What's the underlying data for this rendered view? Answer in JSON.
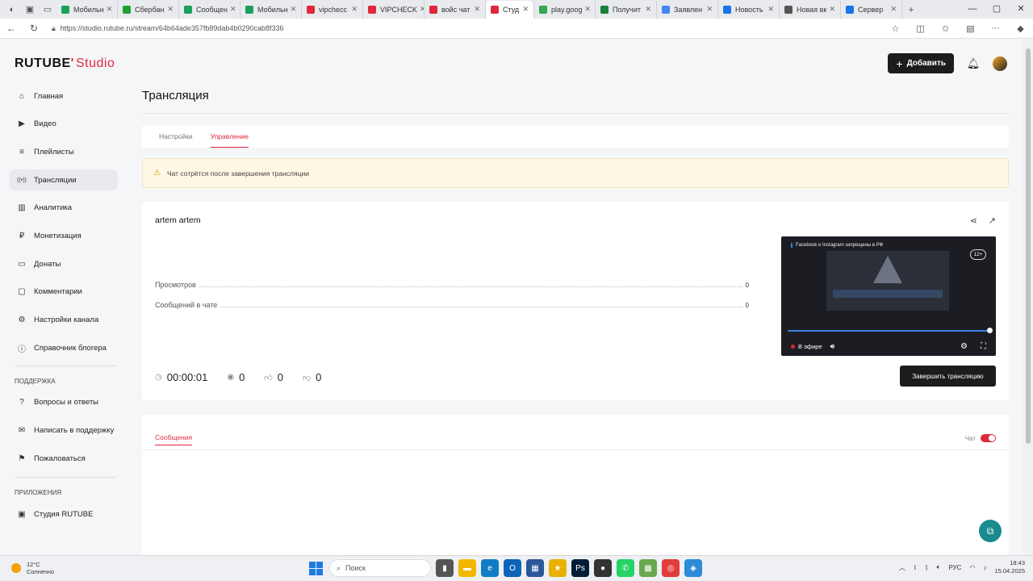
{
  "browser": {
    "tabs": [
      {
        "label": "Мобильн",
        "color": "#19a05b"
      },
      {
        "label": "Сбербан",
        "color": "#21a038"
      },
      {
        "label": "Сообщен",
        "color": "#19a05b"
      },
      {
        "label": "Мобильн",
        "color": "#19a05b"
      },
      {
        "label": "vipchecс",
        "color": "#e0283c"
      },
      {
        "label": "VIPCHECK",
        "color": "#e0283c"
      },
      {
        "label": "войс чат",
        "color": "#e0283c"
      },
      {
        "label": "Студ",
        "color": "#e0283c"
      },
      {
        "label": "play.goog",
        "color": "#34a853"
      },
      {
        "label": "Получит",
        "color": "#188038"
      },
      {
        "label": "Заявлен",
        "color": "#4285f4"
      },
      {
        "label": "Новость",
        "color": "#1a73e8"
      },
      {
        "label": "Новая вк",
        "color": "#555555"
      },
      {
        "label": "Сервер",
        "color": "#1a73e8"
      }
    ],
    "url": "https://studio.rutube.ru/stream/64b64ade357fb89dab4b0290cab8f336"
  },
  "app": {
    "logo": "RUTUBE",
    "logo_suffix": "Studio",
    "add_button": "Добавить"
  },
  "sidebar": {
    "items": [
      {
        "label": "Главная",
        "icon": "home-icon"
      },
      {
        "label": "Видео",
        "icon": "video-icon"
      },
      {
        "label": "Плейлисты",
        "icon": "playlist-icon"
      },
      {
        "label": "Трансляции",
        "icon": "broadcast-icon"
      },
      {
        "label": "Аналитика",
        "icon": "analytics-icon"
      },
      {
        "label": "Монетизация",
        "icon": "ruble-icon"
      },
      {
        "label": "Донаты",
        "icon": "donate-icon"
      },
      {
        "label": "Комментарии",
        "icon": "comment-icon"
      },
      {
        "label": "Настройки канала",
        "icon": "gear-icon"
      },
      {
        "label": "Справочник блогера",
        "icon": "info-icon"
      }
    ],
    "support_heading": "ПОДДЕРЖКА",
    "support_items": [
      {
        "label": "Вопросы и ответы"
      },
      {
        "label": "Написать в поддержку"
      },
      {
        "label": "Пожаловаться"
      }
    ],
    "apps_heading": "ПРИЛОЖЕНИЯ",
    "apps_items": [
      {
        "label": "Студия RUTUBE"
      }
    ]
  },
  "page": {
    "title": "Трансляция",
    "tabs": [
      {
        "label": "Настройки"
      },
      {
        "label": "Управление"
      }
    ],
    "warning": "Чат сотрётся после завершения трансляции"
  },
  "stream": {
    "name": "artem artem",
    "views_label": "Просмотров",
    "views_value": "0",
    "chat_messages_label": "Сообщений в чате",
    "chat_messages_value": "0",
    "duration": "00:00:01",
    "viewers": "0",
    "likes": "0",
    "dislikes": "0",
    "end_button": "Завершить трансляцию",
    "player": {
      "banner": "Facebook и Instagram запрещены в РФ",
      "age": "12+",
      "live_label": "В эфире"
    }
  },
  "chat": {
    "tab": "Сообщения",
    "toggle_label": "Чат"
  },
  "taskbar": {
    "temperature": "12°C",
    "weather": "Солнечно",
    "search": "Поиск",
    "lang": "РУС",
    "time": "18:43",
    "date": "15.04.2025"
  }
}
